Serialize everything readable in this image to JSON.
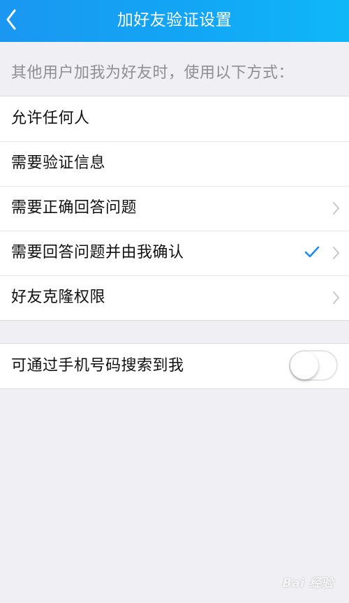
{
  "header": {
    "title": "加好友验证设置",
    "back_icon": "chevron-left-icon"
  },
  "section": {
    "caption": "其他用户加我为好友时，使用以下方式："
  },
  "options": [
    {
      "label": "允许任何人",
      "selected": false,
      "has_arrow": false
    },
    {
      "label": "需要验证信息",
      "selected": false,
      "has_arrow": false
    },
    {
      "label": "需要正确回答问题",
      "selected": false,
      "has_arrow": true
    },
    {
      "label": "需要回答问题并由我确认",
      "selected": true,
      "has_arrow": true
    },
    {
      "label": "好友克隆权限",
      "selected": false,
      "has_arrow": true
    }
  ],
  "search_by_phone": {
    "label": "可通过手机号码搜索到我",
    "enabled": false
  },
  "watermark": {
    "text": "Bai 经验"
  },
  "colors": {
    "accent": "#1a8cf0",
    "header_start": "#1a97f1",
    "header_end": "#0fb7f8",
    "background": "#efeff4"
  }
}
